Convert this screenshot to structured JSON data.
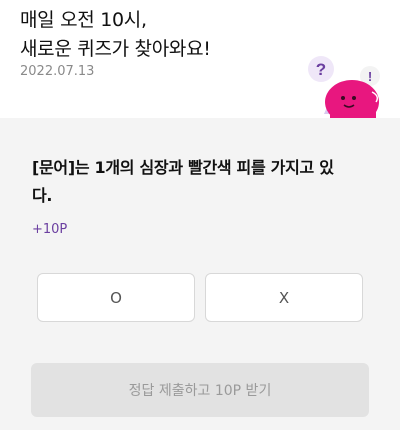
{
  "header": {
    "title_line1": "매일 오전 10시,",
    "title_line2": "새로운 퀴즈가 찾아와요!",
    "date": "2022.07.13"
  },
  "mascot": {
    "question_mark": "?",
    "exclamation_mark": "!"
  },
  "quiz": {
    "question_line1": "[문어]는 1개의 심장과 빨간색 피를 가지고 있",
    "question_line2": "다.",
    "points": "+10P",
    "options": [
      "O",
      "X"
    ],
    "submit_label": "정답 제출하고 10P 받기"
  },
  "colors": {
    "accent_purple": "#6b3fa0",
    "mascot_pink": "#e8177f",
    "panel_bg": "#f4f4f4"
  }
}
